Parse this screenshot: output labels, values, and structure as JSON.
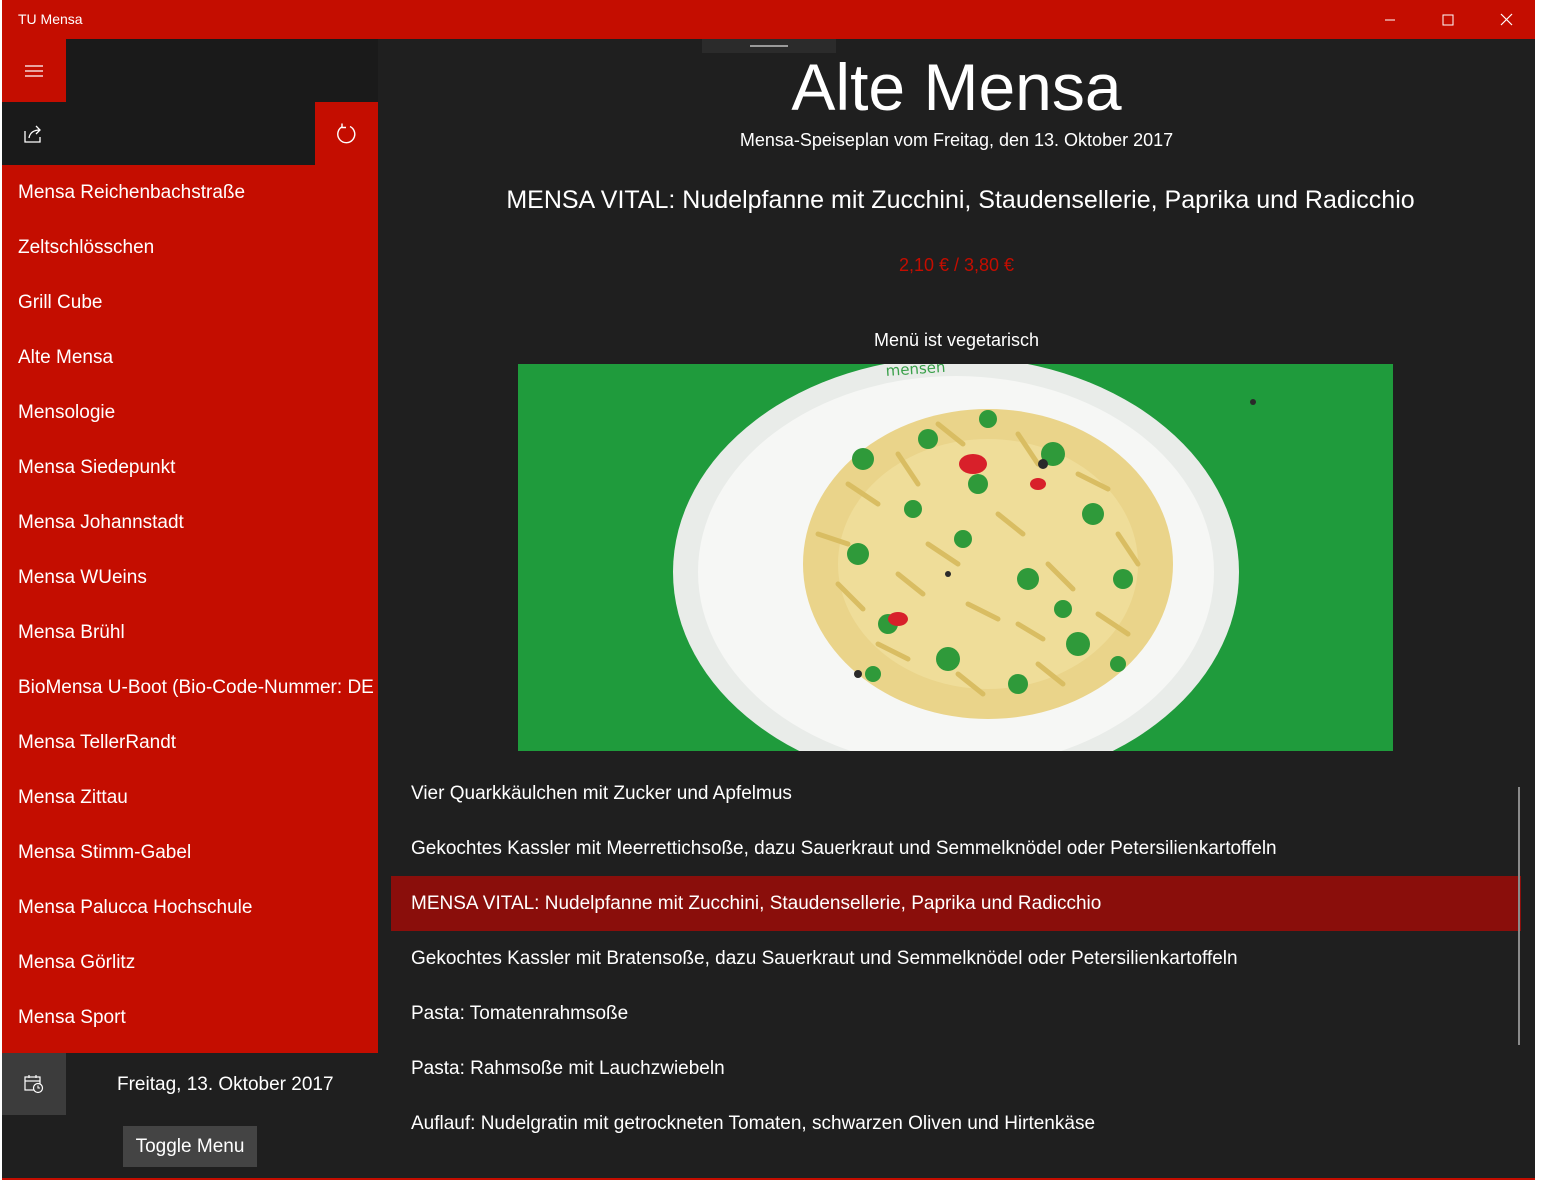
{
  "window": {
    "title": "TU Mensa"
  },
  "sidebar": {
    "menu_icon": "hamburger-icon",
    "share_icon": "share-icon",
    "refresh_icon": "refresh-icon",
    "items": [
      {
        "label": "Mensa Reichenbachstraße"
      },
      {
        "label": "Zeltschlösschen"
      },
      {
        "label": "Grill Cube"
      },
      {
        "label": "Alte Mensa"
      },
      {
        "label": "Mensologie"
      },
      {
        "label": "Mensa Siedepunkt"
      },
      {
        "label": "Mensa Johannstadt"
      },
      {
        "label": "Mensa WUeins"
      },
      {
        "label": "Mensa Brühl"
      },
      {
        "label": "BioMensa U-Boot (Bio-Code-Nummer: DE"
      },
      {
        "label": "Mensa TellerRandt"
      },
      {
        "label": "Mensa Zittau"
      },
      {
        "label": "Mensa Stimm-Gabel"
      },
      {
        "label": "Mensa Palucca Hochschule"
      },
      {
        "label": "Mensa Görlitz"
      },
      {
        "label": "Mensa Sport"
      }
    ],
    "calendar_icon": "calendar-icon",
    "date": "Freitag, 13. Oktober 2017",
    "toggle_label": "Toggle Menu"
  },
  "main": {
    "title": "Alte Mensa",
    "subtitle": "Mensa-Speiseplan vom Freitag, den 13. Oktober 2017",
    "dish_title": "MENSA VITAL: Nudelpfanne mit Zucchini, Staudensellerie, Paprika und Radicchio",
    "price": "2,10 € / 3,80 €",
    "note": "Menü ist vegetarisch",
    "photo_text": "mensen",
    "meals": [
      {
        "label": "Vier Quarkkäulchen mit Zucker und Apfelmus"
      },
      {
        "label": "Gekochtes Kassler mit Meerrettichsoße, dazu Sauerkraut und Semmelknödel oder Petersilienkartoffeln"
      },
      {
        "label": "MENSA VITAL: Nudelpfanne mit Zucchini, Staudensellerie, Paprika und Radicchio",
        "selected": true
      },
      {
        "label": "Gekochtes Kassler mit Bratensoße, dazu Sauerkraut und Semmelknödel oder Petersilienkartoffeln"
      },
      {
        "label": "Pasta: Tomatenrahmsoße"
      },
      {
        "label": "Pasta: Rahmsoße mit Lauchzwiebeln"
      },
      {
        "label": "Auflauf: Nudelgratin mit getrockneten Tomaten, schwarzen Oliven und Hirtenkäse"
      }
    ]
  },
  "colors": {
    "accent": "#c40d00",
    "selected_row": "#8a0e0b",
    "background": "#1f1f1f"
  }
}
